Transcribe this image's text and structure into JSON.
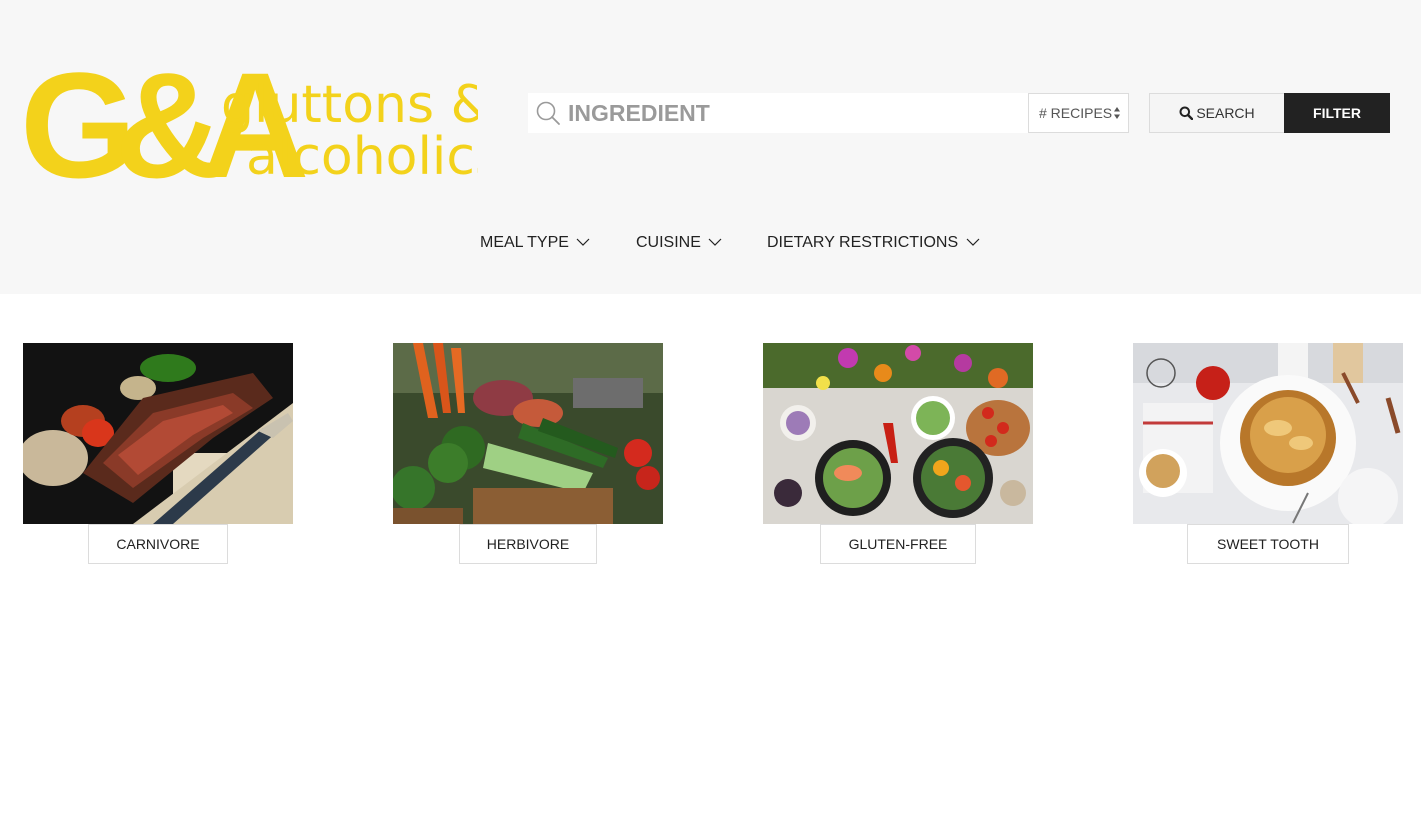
{
  "brand": {
    "monogram": "G&A",
    "name_line1": "gluttons &",
    "name_line2": "alcoholics.",
    "color": "#f3d21b"
  },
  "search": {
    "placeholder": "INGREDIENT",
    "value": "",
    "recipes_select": "# RECIPES",
    "search_label": "SEARCH",
    "filter_label": "FILTER"
  },
  "nav": {
    "items": [
      {
        "label": "MEAL TYPE",
        "icon": "chevron-down-icon"
      },
      {
        "label": "CUISINE",
        "icon": "chevron-down-icon"
      },
      {
        "label": "DIETARY RESTRICTIONS",
        "icon": "chevron-down-icon"
      }
    ]
  },
  "categories": [
    {
      "label": "CARNIVORE",
      "image": "steak-photo"
    },
    {
      "label": "HERBIVORE",
      "image": "vegetables-photo"
    },
    {
      "label": "GLUTEN-FREE",
      "image": "salad-bowls-photo"
    },
    {
      "label": "SWEET TOOTH",
      "image": "apple-pie-photo"
    }
  ],
  "colors": {
    "header_bg": "#f7f7f7",
    "filter_bg": "#222222",
    "accent": "#f3d21b"
  }
}
